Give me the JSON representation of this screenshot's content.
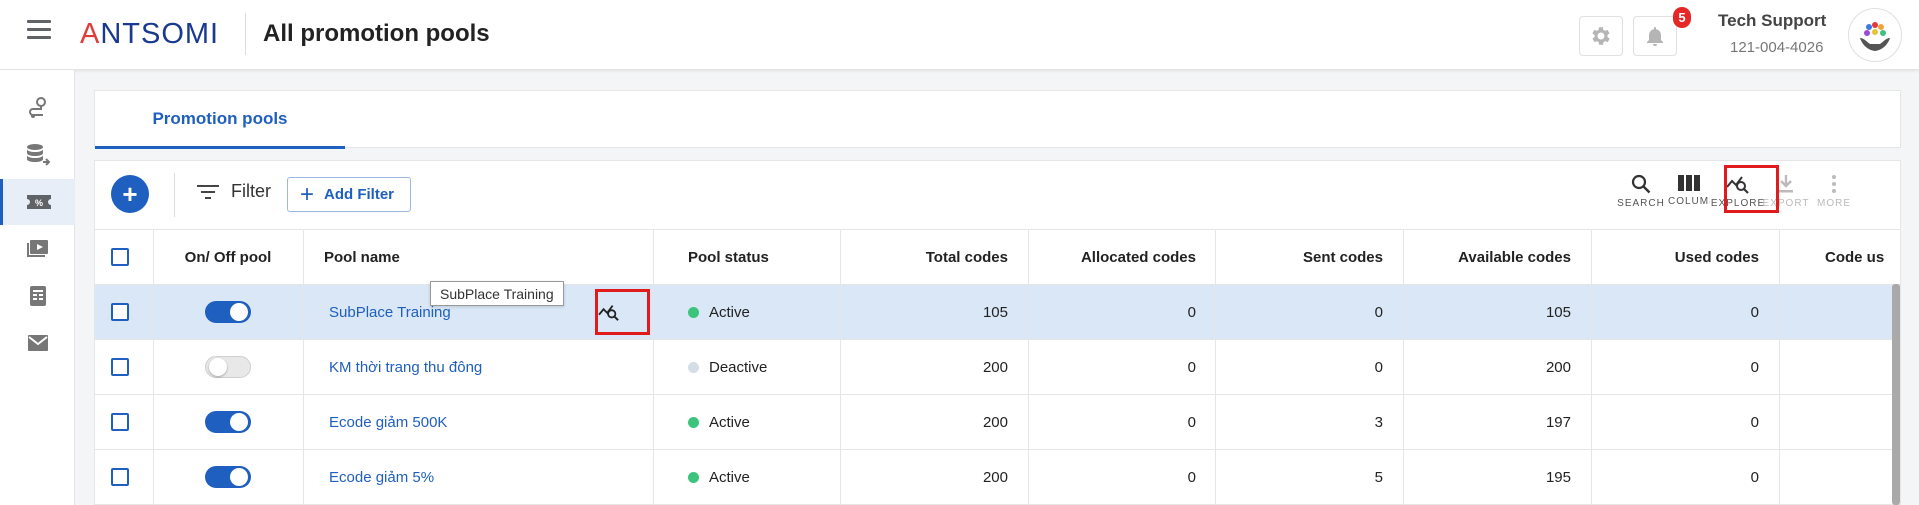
{
  "header": {
    "logo_text": "ANTSOMI",
    "title": "All promotion pools",
    "notification_count": "5",
    "user_name": "Tech Support",
    "user_phone": "121-004-4026"
  },
  "tabs": [
    {
      "label": "Promotion pools",
      "active": true
    }
  ],
  "toolbar": {
    "filter_label": "Filter",
    "add_filter_label": "Add Filter",
    "tools": [
      {
        "label": "SEARCH",
        "icon": "search-icon",
        "enabled": true
      },
      {
        "label": "COLUMN",
        "icon": "columns-icon",
        "enabled": true
      },
      {
        "label": "EXPLORE",
        "icon": "explore-icon",
        "enabled": true
      },
      {
        "label": "EXPORT",
        "icon": "download-icon",
        "enabled": false
      },
      {
        "label": "MORE",
        "icon": "more-vertical-icon",
        "enabled": false
      }
    ]
  },
  "table": {
    "columns": [
      "On/ Off pool",
      "Pool name",
      "Pool status",
      "Total codes",
      "Allocated codes",
      "Sent codes",
      "Available codes",
      "Used codes",
      "Code us"
    ],
    "rows": [
      {
        "on": true,
        "name": "SubPlace Training",
        "status": "Active",
        "total": "105",
        "allocated": "0",
        "sent": "0",
        "available": "105",
        "used": "0"
      },
      {
        "on": false,
        "name": "KM thời trang thu đông",
        "status": "Deactive",
        "total": "200",
        "allocated": "0",
        "sent": "0",
        "available": "200",
        "used": "0"
      },
      {
        "on": true,
        "name": "Ecode giảm 500K",
        "status": "Active",
        "total": "200",
        "allocated": "0",
        "sent": "3",
        "available": "197",
        "used": "0"
      },
      {
        "on": true,
        "name": "Ecode giảm 5%",
        "status": "Active",
        "total": "200",
        "allocated": "0",
        "sent": "5",
        "available": "195",
        "used": "0"
      }
    ]
  },
  "tooltip": "SubPlace Training",
  "colors": {
    "primary": "#1f5fbf",
    "active_dot": "#3cc47c",
    "deactive_dot": "#d5dde6",
    "highlight": "#e01b1b"
  }
}
